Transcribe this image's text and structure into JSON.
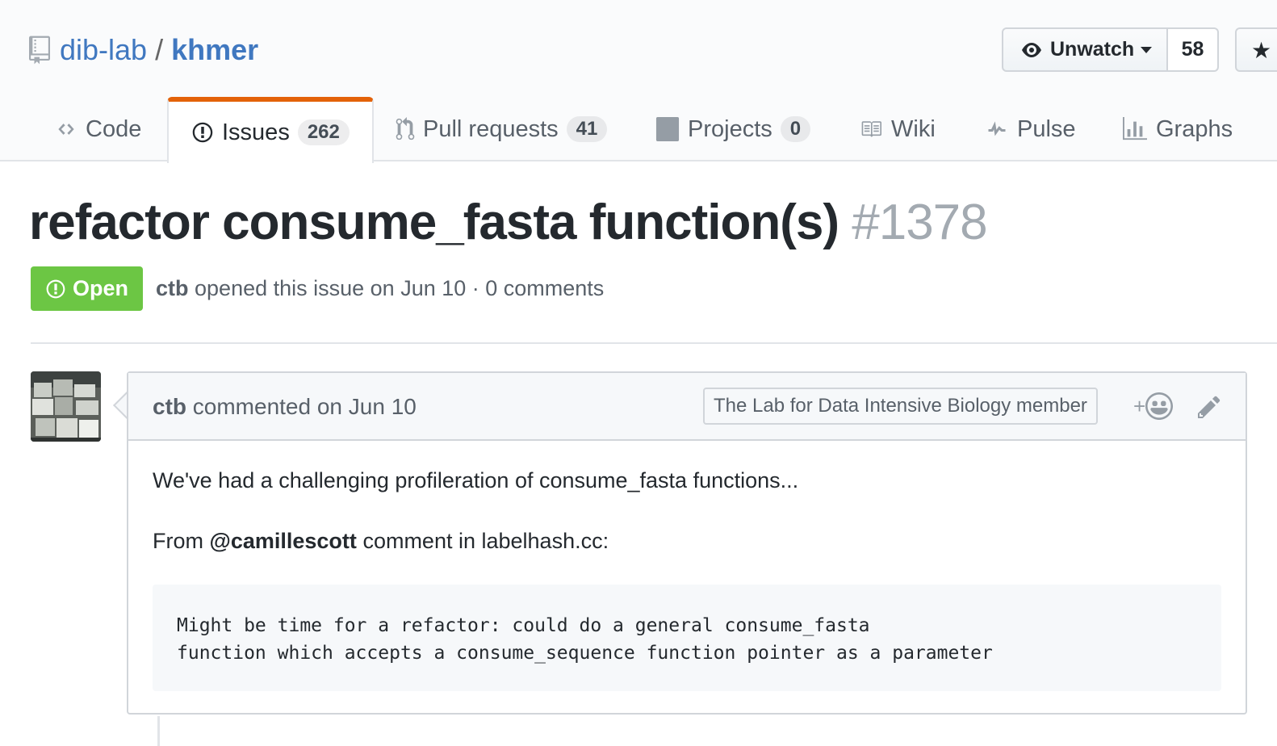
{
  "repo": {
    "owner": "dib-lab",
    "separator": "/",
    "name": "khmer"
  },
  "actions": {
    "watch_label": "Unwatch",
    "watch_count": "58"
  },
  "tabs": [
    {
      "label": "Code",
      "count": null,
      "icon": "code-icon"
    },
    {
      "label": "Issues",
      "count": "262",
      "icon": "issue-opened-icon",
      "selected": true
    },
    {
      "label": "Pull requests",
      "count": "41",
      "icon": "git-pull-request-icon"
    },
    {
      "label": "Projects",
      "count": "0",
      "icon": "project-icon"
    },
    {
      "label": "Wiki",
      "count": null,
      "icon": "book-icon"
    },
    {
      "label": "Pulse",
      "count": null,
      "icon": "pulse-icon"
    },
    {
      "label": "Graphs",
      "count": null,
      "icon": "graph-icon"
    }
  ],
  "issue": {
    "title": "refactor consume_fasta function(s)",
    "number": "#1378",
    "state": "Open",
    "author": "ctb",
    "meta": "opened this issue on Jun 10 · 0 comments"
  },
  "comment": {
    "author": "ctb",
    "action": "commented on Jun 10",
    "label": "The Lab for Data Intensive Biology member",
    "reaction": "+",
    "body_p1": "We've had a challenging profileration of consume_fasta functions...",
    "body_p2_prefix": "From",
    "body_p2_mention": "@camillescott",
    "body_p2_suffix": "comment in labelhash.cc:",
    "code": "Might be time for a refactor: could do a general consume_fasta\nfunction which accepts a consume_sequence function pointer as a parameter"
  },
  "colors": {
    "accent_link": "#4078c0",
    "open_state": "#6cc644",
    "selected_tab_border": "#e36209"
  }
}
